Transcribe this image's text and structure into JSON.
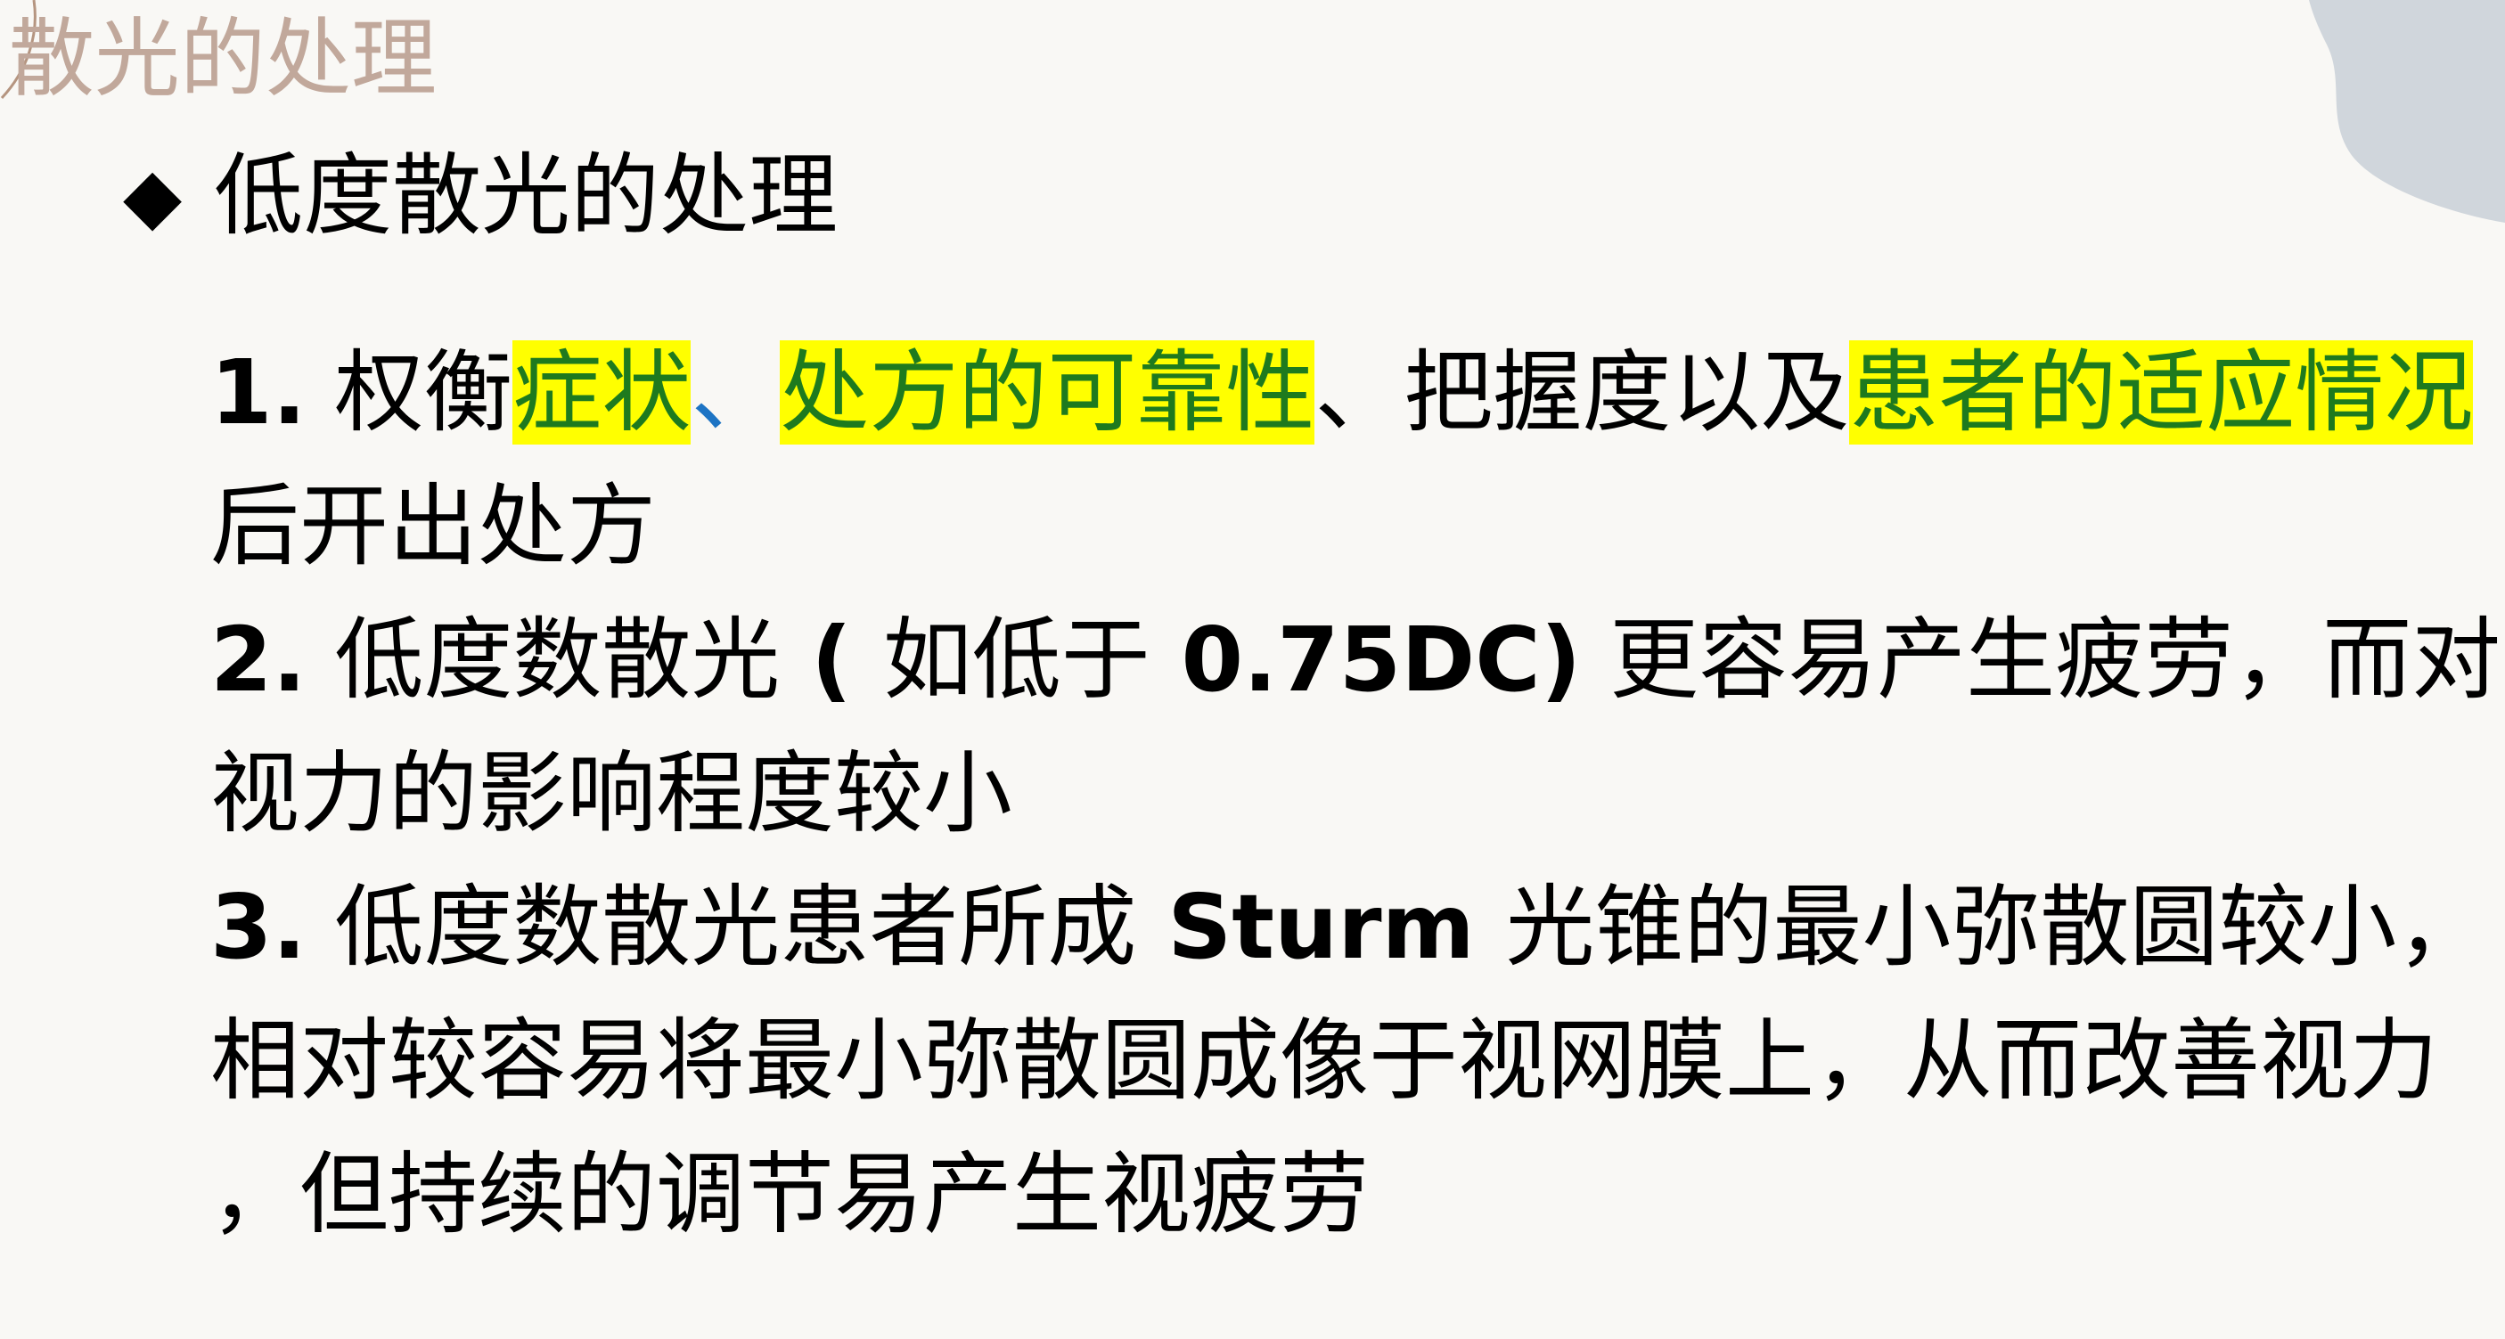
{
  "slide_title": "散光的处理",
  "bullet": {
    "marker": "◆",
    "text": "低度散光的处理"
  },
  "points": [
    {
      "number": "1.",
      "intro": " 权衡",
      "hl_1": "症状",
      "sep": "、",
      "hl_2": "处方的可靠性",
      "mid": "、把握度以及",
      "hl_3": "患者的适应情况",
      "continuation": "后开出处方"
    },
    {
      "number": "2.",
      "text_1": " 低度数散光",
      "paren_open": " ( ",
      "text_2": "如低于",
      "value": " 0.75DC)",
      "text_3": " 更容易产生疲劳，而对",
      "continuation": "视力的影响程度较小"
    },
    {
      "number": "3.",
      "text_1": " 低度数散光患者所成",
      "term": " Sturm ",
      "text_2": "光锥的最小弥散圆较小，",
      "line_2": "相对较容易将最小弥散圆成像于视网膜上，从而改善视力",
      "line_3": "，但持续的调节易产生视疲劳"
    }
  ],
  "colors": {
    "background": "#f9f8f5",
    "title": "#c1a89b",
    "highlight_bg": "#ffff00",
    "highlight_text": "#1e7a1e",
    "separator_blue": "#1d74c4",
    "deco_shape": "#d0d6dc"
  }
}
